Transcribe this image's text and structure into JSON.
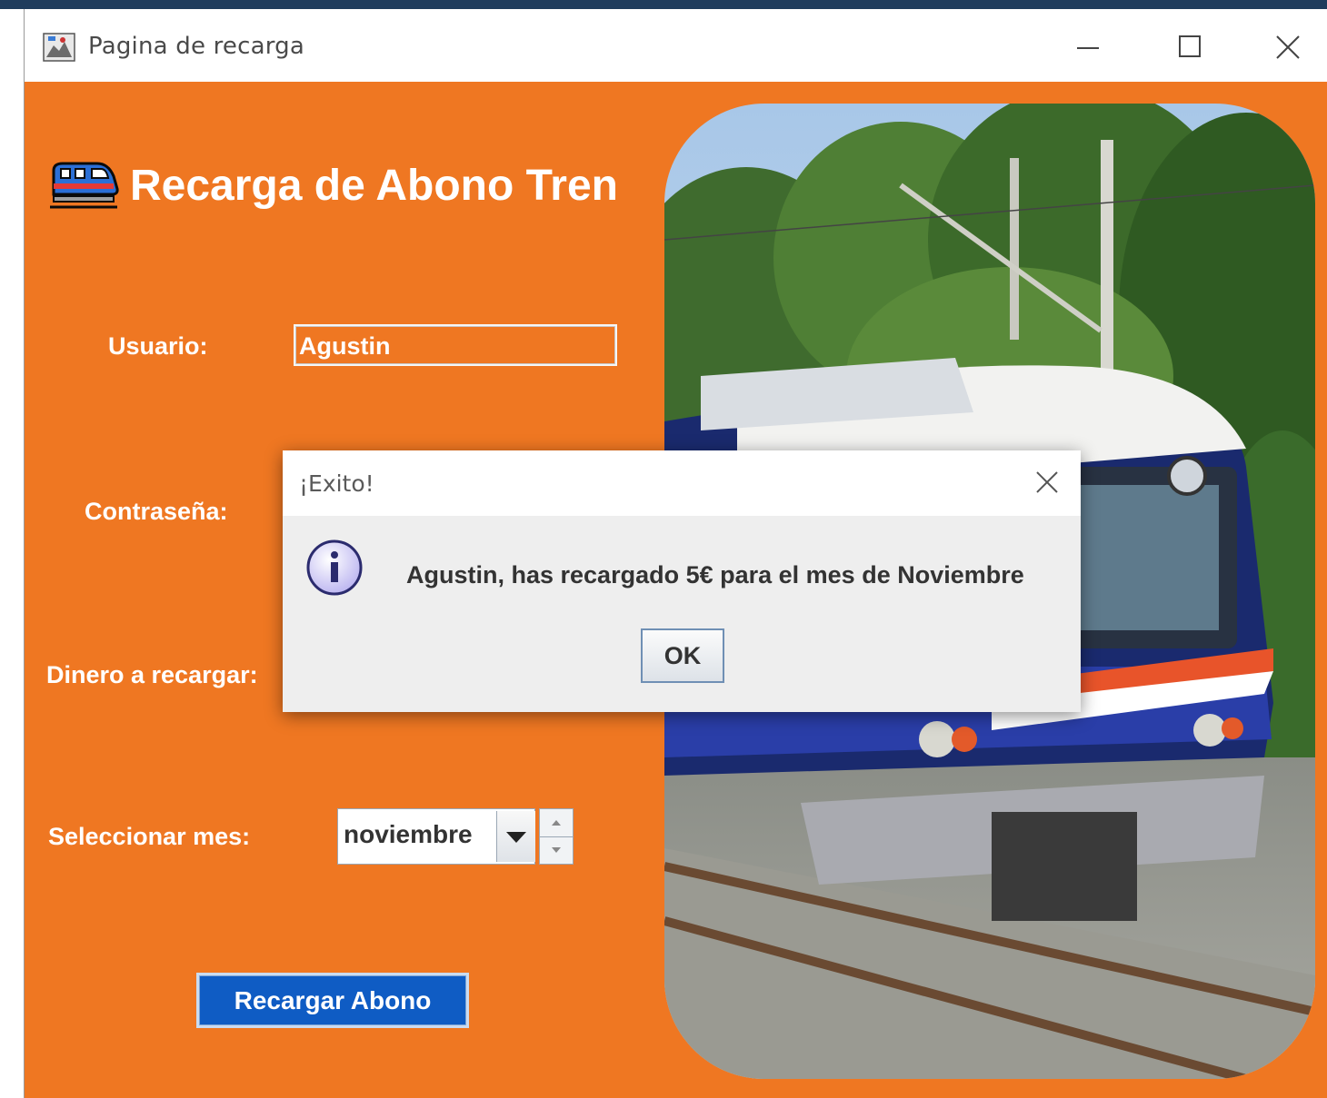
{
  "window": {
    "title": "Pagina de recarga",
    "icon": "java-app-icon",
    "controls": [
      "minimize-icon",
      "maximize-icon",
      "close-icon"
    ]
  },
  "form": {
    "heading": "Recarga de Abono Tren",
    "heading_icon": "train-icon",
    "user_label": "Usuario:",
    "user_value": "Agustin",
    "password_label": "Contraseña:",
    "money_label": "Dinero a recargar:",
    "month_label": "Seleccionar mes:",
    "month_value": "noviembre",
    "submit_label": "Recargar Abono"
  },
  "dialog": {
    "title": "¡Exito!",
    "icon": "info-icon",
    "message": "Agustin, has recargado 5€ para el mes de Noviembre",
    "ok_label": "OK"
  },
  "colors": {
    "background": "#ef7722",
    "button": "#0f5cc4"
  }
}
